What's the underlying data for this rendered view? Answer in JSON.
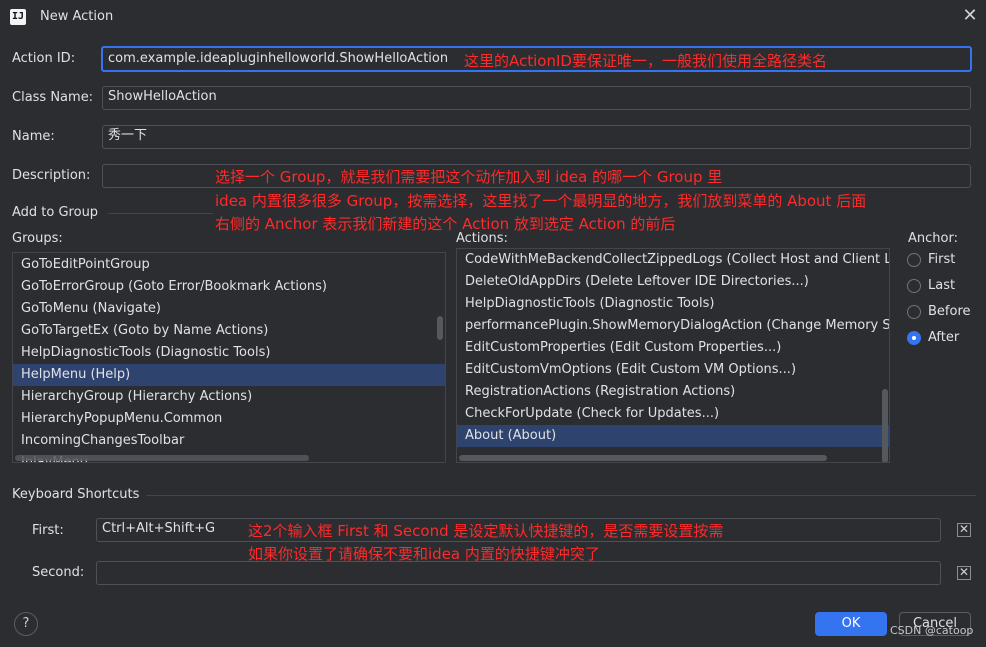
{
  "window": {
    "title": "New Action",
    "app_icon": "IJ",
    "close_glyph": "✕"
  },
  "action_id": {
    "label": "Action ID:",
    "value": "com.example.ideapluginhelloworld.ShowHelloAction",
    "note": "这里的ActionID要保证唯一，一般我们使用全路径类名"
  },
  "class_name": {
    "label": "Class Name:",
    "value": "ShowHelloAction"
  },
  "name": {
    "label": "Name:",
    "value": "秀一下"
  },
  "description": {
    "label": "Description:",
    "value": "",
    "notes": [
      "选择一个 Group，就是我们需要把这个动作加入到 idea 的哪一个 Group 里",
      "idea 内置很多很多 Group，按需选择，这里找了一个最明显的地方，我们放到菜单的 About 后面",
      "右侧的 Anchor 表示我们新建的这个 Action 放到选定 Action 的前后"
    ]
  },
  "add_to_group": {
    "section_label": "Add to Group",
    "groups_label": "Groups:",
    "groups": [
      "GoToEditPointGroup",
      "GoToErrorGroup (Goto Error/Bookmark Actions)",
      "GoToMenu (Navigate)",
      "GoToTargetEx (Goto by Name Actions)",
      "HelpDiagnosticTools (Diagnostic Tools)",
      "HelpMenu (Help)",
      "HierarchyGroup (Hierarchy Actions)",
      "HierarchyPopupMenu.Common",
      "IncomingChangesToolbar",
      "InlayMenu"
    ],
    "groups_selected": "HelpMenu (Help)",
    "actions_label": "Actions:",
    "actions": [
      "CodeWithMeBackendCollectZippedLogs (Collect Host and Client Logs)",
      "DeleteOldAppDirs (Delete Leftover IDE Directories...)",
      "HelpDiagnosticTools (Diagnostic Tools)",
      "performancePlugin.ShowMemoryDialogAction (Change Memory Settings)",
      "EditCustomProperties (Edit Custom Properties...)",
      "EditCustomVmOptions (Edit Custom VM Options...)",
      "RegistrationActions (Registration Actions)",
      "CheckForUpdate (Check for Updates...)",
      "About (About)"
    ],
    "actions_selected": "About (About)",
    "anchor_label": "Anchor:",
    "anchors": [
      "First",
      "Last",
      "Before",
      "After"
    ],
    "anchor_selected": "After"
  },
  "keyboard_shortcuts": {
    "section_label": "Keyboard Shortcuts",
    "first_label": "First:",
    "first_value": "Ctrl+Alt+Shift+G",
    "second_label": "Second:",
    "second_value": "",
    "notes": [
      "这2个输入框 First 和 Second 是设定默认快捷键的，是否需要设置按需",
      "如果你设置了请确保不要和idea 内置的快捷键冲突了"
    ],
    "clear_glyph": "✕"
  },
  "footer": {
    "help_label": "?",
    "ok_label": "OK",
    "cancel_label": "Cancel",
    "watermark": "CSDN @catoop"
  },
  "colors": {
    "accent": "#3574f0",
    "background": "#2b2d30",
    "selection": "#2e436e",
    "annotation": "#ff2a2a"
  }
}
